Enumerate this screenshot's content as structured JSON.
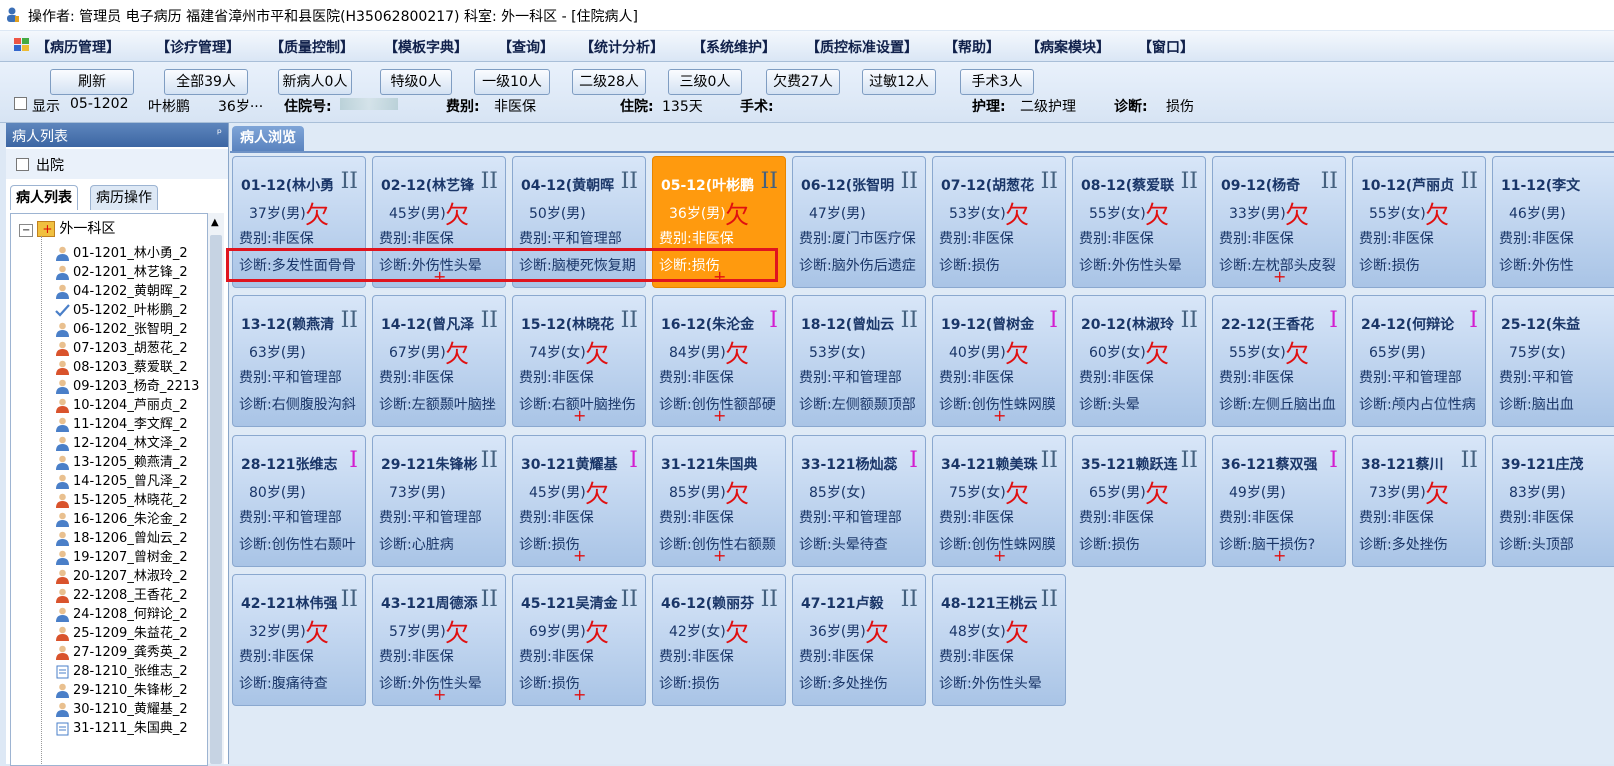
{
  "titlebar": {
    "text": "操作者: 管理员 电子病历  福建省漳州市平和县医院(H35062800217)  科室: 外一科区 - [住院病人]"
  },
  "menu": [
    "【病历管理】",
    "【诊疗管理】",
    "【质量控制】",
    "【模板字典】",
    "【查询】",
    "【统计分析】",
    "【系统维护】",
    "【质控标准设置】",
    "【帮助】",
    "【病案模块】",
    "【窗口】"
  ],
  "toolbar": {
    "buttons": [
      "刷新",
      "全部39人",
      "新病人0人",
      "特级0人",
      "一级10人",
      "二级28人",
      "三级0人",
      "欠费27人",
      "过敏12人",
      "手术3人"
    ],
    "show_label": "显示",
    "bed": "05-1202",
    "name": "叶彬鹏",
    "age": "36岁···",
    "admission_no_label": "住院号:",
    "fee_label": "费别:",
    "fee_value": "非医保",
    "stay_label": "住院:",
    "stay_value": "135天",
    "surgery_label": "手术:",
    "nursing_label": "护理:",
    "nursing_value": "二级护理",
    "diagnosis_label": "诊断:",
    "diagnosis_value": "损伤"
  },
  "left": {
    "header": "病人列表",
    "pin": "ᵖ",
    "discharge": "出院",
    "tab_list": "病人列表",
    "tab_ops": "病历操作",
    "root": "外一科区",
    "patients": [
      "01-1201_林小勇_2",
      "02-1201_林艺锋_2",
      "04-1202_黄朝晖_2",
      "05-1202_叶彬鹏_2",
      "06-1202_张智明_2",
      "07-1203_胡葱花_2",
      "08-1203_蔡爱联_2",
      "09-1203_杨奇_2213",
      "10-1204_芦丽贞_2",
      "11-1204_李文辉_2",
      "12-1204_林文泽_2",
      "13-1205_赖燕清_2",
      "14-1205_曾凡泽_2",
      "15-1205_林晓花_2",
      "16-1206_朱沦金_2",
      "18-1206_曾灿云_2",
      "19-1207_曾树金_2",
      "20-1207_林淑玲_2",
      "22-1208_王香花_2",
      "24-1208_何辩论_2",
      "25-1209_朱益花_2",
      "27-1209_龚秀英_2",
      "28-1210_张维志_2",
      "29-1210_朱锋彬_2",
      "30-1210_黄耀基_2",
      "31-1211_朱国典_2"
    ],
    "patient_icons": [
      "male",
      "male",
      "male",
      "check",
      "male",
      "female",
      "female",
      "male",
      "female",
      "male",
      "male",
      "male",
      "male",
      "female",
      "male",
      "male",
      "male",
      "female",
      "female",
      "male",
      "female",
      "female",
      "doc",
      "male",
      "male",
      "doc"
    ]
  },
  "main_tab": "病人浏览",
  "cards": [
    {
      "name": "01-12(林小勇",
      "level": "II",
      "age": "37岁(男)",
      "owe": "欠",
      "fee": "费别:非医保",
      "dx": "诊断:多发性面骨骨",
      "plus": ""
    },
    {
      "name": "02-12(林艺锋",
      "level": "II",
      "age": "45岁(男)",
      "owe": "欠",
      "fee": "费别:非医保",
      "dx": "诊断:外伤性头晕",
      "plus": "+"
    },
    {
      "name": "04-12(黄朝晖",
      "level": "II",
      "age": "50岁(男)",
      "owe": "",
      "fee": "费别:平和管理部",
      "dx": "诊断:脑梗死恢复期",
      "plus": ""
    },
    {
      "name": "05-12(叶彬鹏",
      "level": "II",
      "age": "36岁(男)",
      "owe": "欠",
      "fee": "费别:非医保",
      "dx": "诊断:损伤",
      "plus": "+",
      "sel": true
    },
    {
      "name": "06-12(张智明",
      "level": "II",
      "age": "47岁(男)",
      "owe": "",
      "fee": "费别:厦门市医疗保",
      "dx": "诊断:脑外伤后遗症",
      "plus": ""
    },
    {
      "name": "07-12(胡葱花",
      "level": "II",
      "age": "53岁(女)",
      "owe": "欠",
      "fee": "费别:非医保",
      "dx": "诊断:损伤",
      "plus": ""
    },
    {
      "name": "08-12(蔡爱联",
      "level": "II",
      "age": "55岁(女)",
      "owe": "欠",
      "fee": "费别:非医保",
      "dx": "诊断:外伤性头晕",
      "plus": ""
    },
    {
      "name": "09-12(杨奇",
      "level": "II",
      "age": "33岁(男)",
      "owe": "欠",
      "fee": "费别:非医保",
      "dx": "诊断:左枕部头皮裂",
      "plus": "+"
    },
    {
      "name": "10-12(芦丽贞",
      "level": "II",
      "age": "55岁(女)",
      "owe": "欠",
      "fee": "费别:非医保",
      "dx": "诊断:损伤",
      "plus": ""
    },
    {
      "name": "11-12(李文",
      "level": "",
      "age": "46岁(男)",
      "owe": "",
      "fee": "费别:非医保",
      "dx": "诊断:外伤性",
      "plus": ""
    },
    {
      "name": "13-12(赖燕清",
      "level": "II",
      "age": "63岁(男)",
      "owe": "",
      "fee": "费别:平和管理部",
      "dx": "诊断:右侧腹股沟斜",
      "plus": ""
    },
    {
      "name": "14-12(曾凡泽",
      "level": "II",
      "age": "67岁(男)",
      "owe": "欠",
      "fee": "费别:非医保",
      "dx": "诊断:左额颞叶脑挫",
      "plus": ""
    },
    {
      "name": "15-12(林晓花",
      "level": "II",
      "age": "74岁(女)",
      "owe": "欠",
      "fee": "费别:非医保",
      "dx": "诊断:右额叶脑挫伤",
      "plus": "+"
    },
    {
      "name": "16-12(朱沦金",
      "level": "I",
      "age": "84岁(男)",
      "owe": "欠",
      "fee": "费别:非医保",
      "dx": "诊断:创伤性额部硬",
      "plus": "+"
    },
    {
      "name": "18-12(曾灿云",
      "level": "II",
      "age": "53岁(女)",
      "owe": "",
      "fee": "费别:平和管理部",
      "dx": "诊断:左侧额颞顶部",
      "plus": ""
    },
    {
      "name": "19-12(曾树金",
      "level": "I",
      "age": "40岁(男)",
      "owe": "欠",
      "fee": "费别:非医保",
      "dx": "诊断:创伤性蛛网膜",
      "plus": "+"
    },
    {
      "name": "20-12(林淑玲",
      "level": "II",
      "age": "60岁(女)",
      "owe": "欠",
      "fee": "费别:非医保",
      "dx": "诊断:头晕",
      "plus": ""
    },
    {
      "name": "22-12(王香花",
      "level": "I",
      "age": "55岁(女)",
      "owe": "欠",
      "fee": "费别:非医保",
      "dx": "诊断:左侧丘脑出血",
      "plus": ""
    },
    {
      "name": "24-12(何辩论",
      "level": "I",
      "age": "65岁(男)",
      "owe": "",
      "fee": "费别:平和管理部",
      "dx": "诊断:颅内占位性病",
      "plus": ""
    },
    {
      "name": "25-12(朱益",
      "level": "",
      "age": "75岁(女)",
      "owe": "",
      "fee": "费别:平和管",
      "dx": "诊断:脑出血",
      "plus": ""
    },
    {
      "name": "28-121张维志",
      "level": "I",
      "age": "80岁(男)",
      "owe": "",
      "fee": "费别:平和管理部",
      "dx": "诊断:创伤性右颞叶",
      "plus": ""
    },
    {
      "name": "29-121朱锋彬",
      "level": "II",
      "age": "73岁(男)",
      "owe": "",
      "fee": "费别:平和管理部",
      "dx": "诊断:心脏病",
      "plus": ""
    },
    {
      "name": "30-121黄耀基",
      "level": "I",
      "age": "45岁(男)",
      "owe": "欠",
      "fee": "费别:非医保",
      "dx": "诊断:损伤",
      "plus": "+"
    },
    {
      "name": "31-121朱国典",
      "level": "",
      "age": "85岁(男)",
      "owe": "欠",
      "fee": "费别:非医保",
      "dx": "诊断:创伤性右额颞",
      "plus": "+"
    },
    {
      "name": "33-121杨灿蕊",
      "level": "I",
      "age": "85岁(女)",
      "owe": "",
      "fee": "费别:平和管理部",
      "dx": "诊断:头晕待查",
      "plus": ""
    },
    {
      "name": "34-121赖美珠",
      "level": "II",
      "age": "75岁(女)",
      "owe": "欠",
      "fee": "费别:非医保",
      "dx": "诊断:创伤性蛛网膜",
      "plus": "+"
    },
    {
      "name": "35-121赖跃连",
      "level": "II",
      "age": "65岁(男)",
      "owe": "欠",
      "fee": "费别:非医保",
      "dx": "诊断:损伤",
      "plus": ""
    },
    {
      "name": "36-121蔡双强",
      "level": "I",
      "age": "49岁(男)",
      "owe": "",
      "fee": "费别:非医保",
      "dx": "诊断:脑干损伤?",
      "plus": "+"
    },
    {
      "name": "38-121蔡川",
      "level": "II",
      "age": "73岁(男)",
      "owe": "欠",
      "fee": "费别:非医保",
      "dx": "诊断:多处挫伤",
      "plus": ""
    },
    {
      "name": "39-121庄茂",
      "level": "",
      "age": "83岁(男)",
      "owe": "",
      "fee": "费别:非医保",
      "dx": "诊断:头顶部",
      "plus": ""
    },
    {
      "name": "42-121林伟强",
      "level": "II",
      "age": "32岁(男)",
      "owe": "欠",
      "fee": "费别:非医保",
      "dx": "诊断:腹痛待查",
      "plus": ""
    },
    {
      "name": "43-121周德添",
      "level": "II",
      "age": "57岁(男)",
      "owe": "欠",
      "fee": "费别:非医保",
      "dx": "诊断:外伤性头晕",
      "plus": "+"
    },
    {
      "name": "45-121吴清金",
      "level": "II",
      "age": "69岁(男)",
      "owe": "欠",
      "fee": "费别:非医保",
      "dx": "诊断:损伤",
      "plus": "+"
    },
    {
      "name": "46-12(赖丽芬",
      "level": "II",
      "age": "42岁(女)",
      "owe": "欠",
      "fee": "费别:非医保",
      "dx": "诊断:损伤",
      "plus": ""
    },
    {
      "name": "47-121卢毅",
      "level": "II",
      "age": "36岁(男)",
      "owe": "欠",
      "fee": "费别:非医保",
      "dx": "诊断:多处挫伤",
      "plus": ""
    },
    {
      "name": "48-121王桃云",
      "level": "II",
      "age": "48岁(女)",
      "owe": "欠",
      "fee": "费别:非医保",
      "dx": "诊断:外伤性头晕",
      "plus": ""
    }
  ],
  "colors": {
    "selected_card": "#ff9a0e",
    "owe": "#e01010",
    "level_one": "#d21fd0",
    "highlight_box": "#e0141e"
  }
}
